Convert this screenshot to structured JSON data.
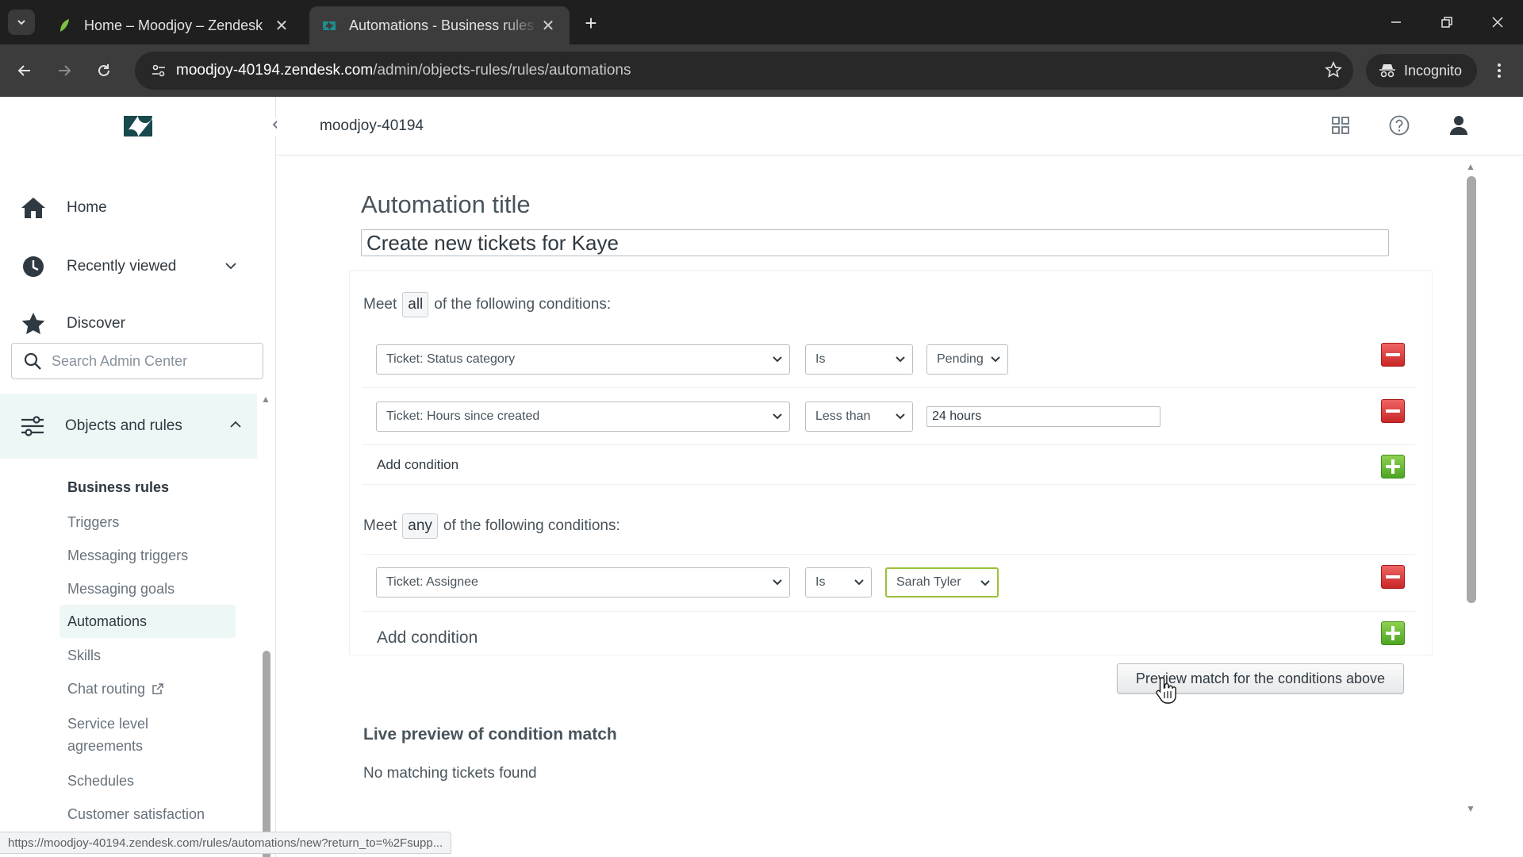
{
  "browser": {
    "tabs": [
      {
        "title": "Home – Moodjoy – Zendesk",
        "active": false
      },
      {
        "title": "Automations - Business rules - Zendesk",
        "active": true
      }
    ],
    "url_host": "moodjoy-40194.zendesk.com",
    "url_path": "/admin/objects-rules/rules/automations",
    "incognito_label": "Incognito",
    "status_url": "https://moodjoy-40194.zendesk.com/rules/automations/new?return_to=%2Fsupp..."
  },
  "app": {
    "org_name": "moodjoy-40194"
  },
  "sidebar": {
    "nav": [
      {
        "label": "Home",
        "icon": "home-icon"
      },
      {
        "label": "Recently viewed",
        "icon": "clock-icon"
      },
      {
        "label": "Discover",
        "icon": "star-icon"
      }
    ],
    "search_placeholder": "Search Admin Center",
    "section": {
      "label": "Objects and rules",
      "icon": "objects-rules-icon"
    },
    "subheading": "Business rules",
    "items": [
      {
        "label": "Triggers"
      },
      {
        "label": "Messaging triggers"
      },
      {
        "label": "Messaging goals"
      },
      {
        "label": "Automations",
        "active": true
      },
      {
        "label": "Skills"
      },
      {
        "label": "Chat routing"
      },
      {
        "label": "Service level agreements"
      },
      {
        "label": "Schedules"
      },
      {
        "label": "Customer satisfaction"
      }
    ]
  },
  "form": {
    "title_label": "Automation title",
    "title_value": "Create new tickets for Kaye",
    "all_block": {
      "meet": "Meet",
      "mode": "all",
      "suffix": "of the following conditions:",
      "conditions": [
        {
          "field": "Ticket: Status category",
          "operator": "Is",
          "value": "Pending"
        },
        {
          "field": "Ticket: Hours since created",
          "operator": "Less than",
          "value": "24 hours"
        }
      ],
      "add_label": "Add condition"
    },
    "any_block": {
      "meet": "Meet",
      "mode": "any",
      "suffix": "of the following conditions:",
      "conditions": [
        {
          "field": "Ticket: Assignee",
          "operator": "Is",
          "value": "Sarah Tyler"
        }
      ],
      "add_label": "Add condition"
    },
    "preview_button": "Preview match for the conditions above",
    "live_preview_title": "Live preview of condition match",
    "live_preview_empty": "No matching tickets found"
  },
  "colors": {
    "accent_bg": "#edf7f5",
    "remove_red": "#d93f3f",
    "add_green": "#6ebe36",
    "focus_green": "#9bc13c"
  }
}
